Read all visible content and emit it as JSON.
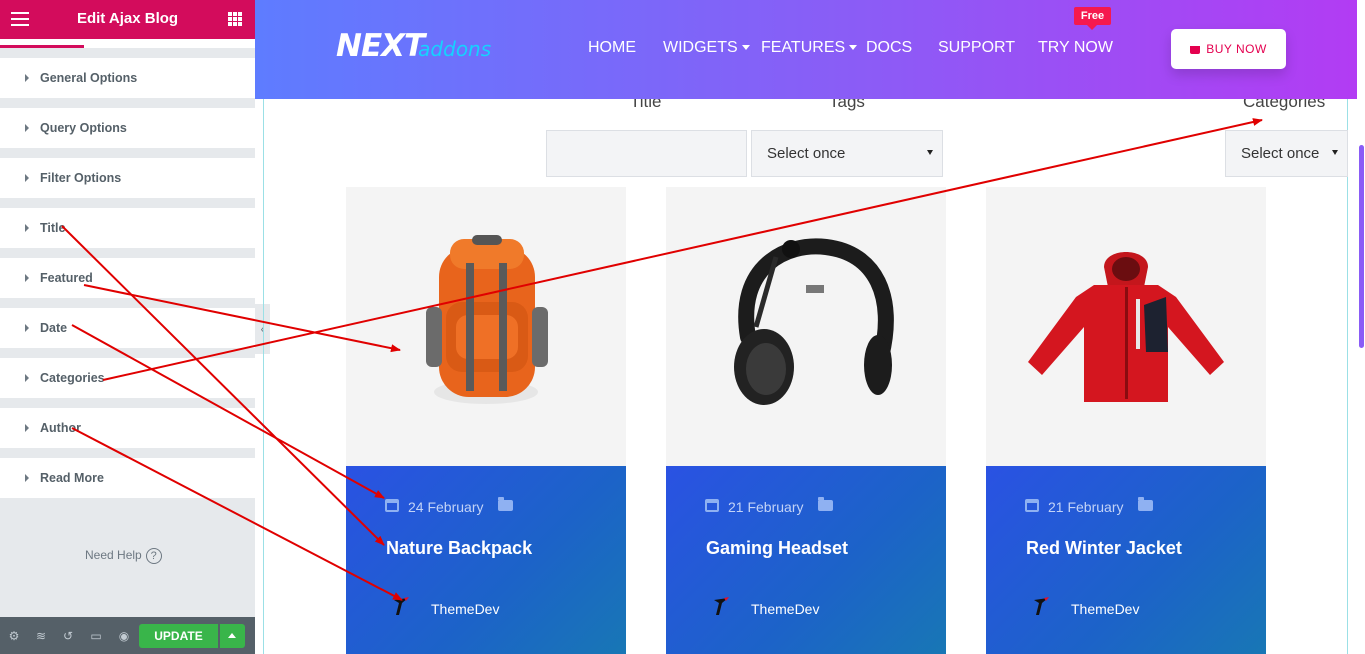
{
  "panel": {
    "title": "Edit Ajax Blog",
    "sections": [
      {
        "label": "General Options"
      },
      {
        "label": "Query Options"
      },
      {
        "label": "Filter Options"
      },
      {
        "label": "Title"
      },
      {
        "label": "Featured"
      },
      {
        "label": "Date"
      },
      {
        "label": "Categories"
      },
      {
        "label": "Author"
      },
      {
        "label": "Read More"
      }
    ],
    "need_help": "Need Help",
    "update_label": "UPDATE"
  },
  "nav": {
    "logo_main": "NEXT",
    "logo_sub": "addons",
    "links": [
      "HOME",
      "WIDGETS",
      "FEATURES",
      "DOCS",
      "SUPPORT",
      "TRY NOW"
    ],
    "free_badge": "Free",
    "buy_now": "BUY NOW"
  },
  "filters": {
    "title_label": "Title",
    "tags_label": "Tags",
    "categories_label": "Categories",
    "tags_select": "Select once",
    "categories_select": "Select once"
  },
  "posts": [
    {
      "date": "24 February",
      "title": "Nature Backpack",
      "author": "ThemeDev",
      "image": "orange-backpack"
    },
    {
      "date": "21 February",
      "title": "Gaming Headset",
      "author": "ThemeDev",
      "image": "black-headset"
    },
    {
      "date": "21 February",
      "title": "Red Winter Jacket",
      "author": "ThemeDev",
      "image": "red-jacket"
    }
  ],
  "colors": {
    "panel_accent": "#d30c5c",
    "nav_gradient_start": "#5e7cff",
    "nav_gradient_end": "#b23cf3",
    "card_blue": "#2a52e3",
    "update_green": "#39b54a",
    "annotation_red": "#e00000"
  }
}
